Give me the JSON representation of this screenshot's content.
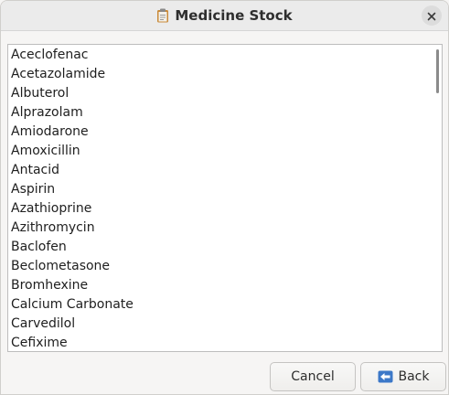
{
  "window": {
    "title": "Medicine Stock",
    "title_icon": "clipboard-icon",
    "close_icon": "close-icon"
  },
  "medicine_list": {
    "items": [
      "Aceclofenac",
      "Acetazolamide",
      "Albuterol",
      "Alprazolam",
      "Amiodarone",
      "Amoxicillin",
      "Antacid",
      "Aspirin",
      "Azathioprine",
      "Azithromycin",
      "Baclofen",
      "Beclometasone",
      "Bromhexine",
      "Calcium Carbonate",
      "Carvedilol",
      "Cefixime"
    ]
  },
  "buttons": {
    "cancel_label": "Cancel",
    "back_label": "Back",
    "back_icon": "back-arrow-icon"
  },
  "colors": {
    "window_bg": "#f6f5f4",
    "titlebar_bg": "#ebebeb",
    "list_bg": "#ffffff",
    "back_icon_blue": "#3c78c8"
  }
}
